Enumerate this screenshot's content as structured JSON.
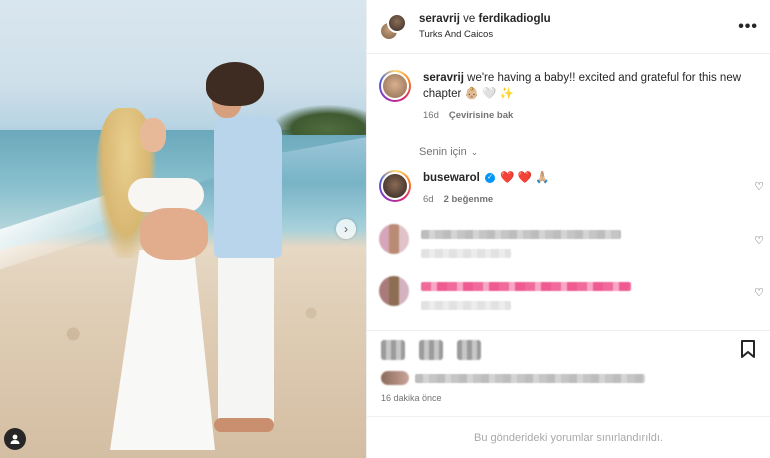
{
  "post": {
    "author1": "seravrij",
    "joiner": "ve",
    "author2": "ferdikadioglu",
    "location": "Turks And Caicos",
    "more_icon": "more-horizontal-icon"
  },
  "caption": {
    "username": "seravrij",
    "text": "we're having a baby!! excited and grateful for this new chapter",
    "emojis": "👶🏼 🤍 ✨",
    "age": "16d",
    "translate": "Çevirisine bak"
  },
  "sort": {
    "label": "Senin için"
  },
  "comments": [
    {
      "username": "busewarol",
      "verified": true,
      "text": "❤️ ❤️ 🙏🏼",
      "age": "6d",
      "likes": "2 beğenme"
    }
  ],
  "post_time": "16 dakika önce",
  "footer": {
    "notice": "Bu gönderideki yorumlar sınırlandırıldı."
  },
  "colors": {
    "accent": "#0095f6",
    "text": "#262626",
    "muted": "#737373"
  }
}
